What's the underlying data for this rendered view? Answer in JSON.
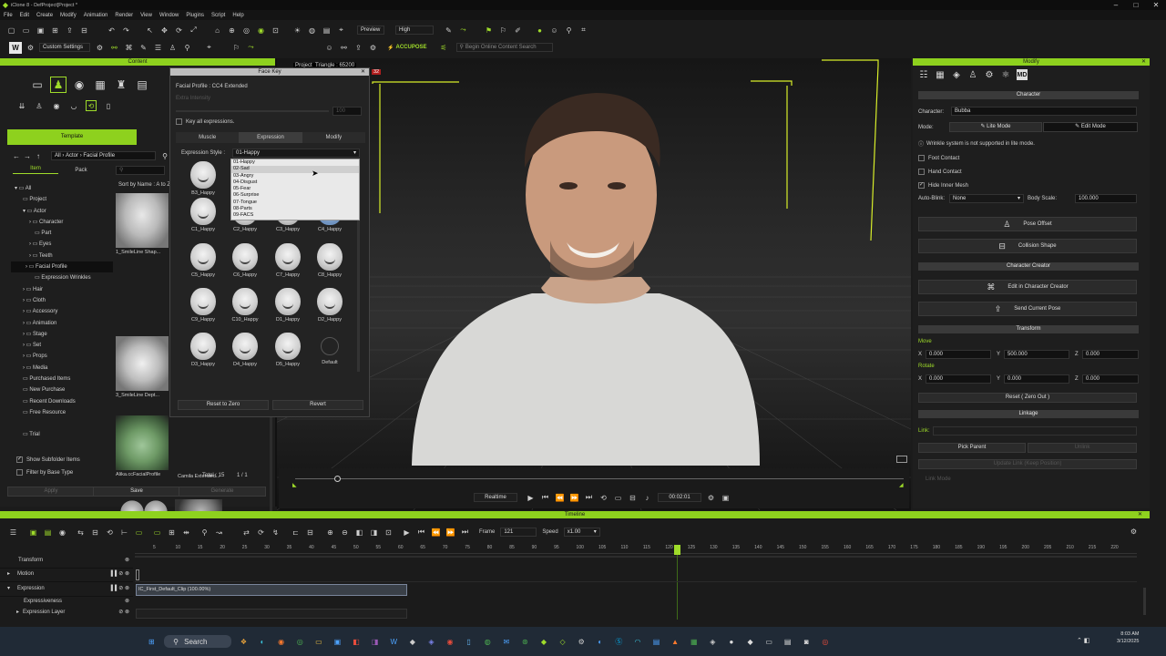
{
  "titlebar": {
    "title": "iClone 8 - DefProject[Project *"
  },
  "menu": [
    "File",
    "Edit",
    "Create",
    "Modify",
    "Animation",
    "Render",
    "View",
    "Window",
    "Plugins",
    "Script",
    "Help"
  ],
  "toolbar": {
    "preview": "Preview",
    "quality": "High",
    "custom": "Custom Settings",
    "accupose": "ACCUPOSE",
    "search_placeholder": "Begin Online Content Search"
  },
  "content": {
    "title": "Content",
    "tab_template": "Template",
    "tab_item": "Item",
    "tab_pack": "Pack",
    "path": [
      "All",
      "Actor",
      "Facial Profile"
    ],
    "sort": "Sort by Name : A to Z",
    "tree": [
      "All",
      "Project",
      "Actor",
      "Character",
      "Part",
      "Eyes",
      "Teeth",
      "Facial Profile",
      "Expression Wrinkles",
      "Hair",
      "Cloth",
      "Accessory",
      "Animation",
      "Stage",
      "Set",
      "Props",
      "Media",
      "Purchased Items",
      "New Purchase",
      "Recent Downloads",
      "Free Resource",
      "Trial"
    ],
    "thumbs": [
      "1_SmileLine Shap...",
      "3_SmileLine Dept...",
      "Alika.ccFacialProfile",
      "Camila Extended..."
    ],
    "show_sub": "Show Subfolder Items",
    "filter_base": "Filter by Base Type",
    "total": "Total : 15",
    "page": "1 / 1",
    "apply": "Apply",
    "save": "Save",
    "generate": "Generate"
  },
  "facekey": {
    "title": "Face Key",
    "profile": "Facial Profile : CC4 Extended",
    "strength": "Extra Intensity",
    "strength_val": "100",
    "key_all": "Key all expressions.",
    "tabs": [
      "Muscle",
      "Expression",
      "Modify"
    ],
    "style_label": "Expression Style :",
    "style_value": "01-Happy",
    "options": [
      "01-Happy",
      "02-Sad",
      "03-Angry",
      "04-Disgust",
      "05-Fear",
      "06-Surprise",
      "07-Tongue",
      "08-Parts",
      "09-FACS"
    ],
    "faces": [
      "B3_Happy",
      "C1_Happy",
      "C2_Happy",
      "C3_Happy",
      "C4_Happy",
      "C5_Happy",
      "C6_Happy",
      "C7_Happy",
      "C8_Happy",
      "C9_Happy",
      "C10_Happy",
      "D1_Happy",
      "D2_Happy",
      "D3_Happy",
      "D4_Happy",
      "D5_Happy",
      "Default"
    ],
    "reset": "Reset to Zero",
    "revert": "Revert"
  },
  "viewport": {
    "stats": "Project_Triangle : 65200",
    "frame_badge": "32"
  },
  "playback": {
    "mode": "Realtime",
    "time": "00:02:01"
  },
  "modify": {
    "title": "Modify",
    "character_section": "Character",
    "character_label": "Character:",
    "character_name": "Bubba",
    "mode_label": "Mode:",
    "lite": "Lite Mode",
    "edit": "Edit Mode",
    "wrinkle_note": "Wrinkle system is not supported in lite mode.",
    "foot": "Foot Contact",
    "hand": "Hand Contact",
    "hide_inner": "Hide Inner Mesh",
    "autoblink_label": "Auto-Blink:",
    "autoblink": "None",
    "bodyscale_label": "Body Scale:",
    "bodyscale": "100.000",
    "pose_offset": "Pose Offset",
    "collision": "Collision Shape",
    "cc_section": "Character Creator",
    "edit_cc": "Edit in Character Creator",
    "send_pose": "Send Current Pose",
    "transform_section": "Transform",
    "move": "Move",
    "rotate": "Rotate",
    "move_x": "0.000",
    "move_y": "500.000",
    "move_z": "0.000",
    "rot_x": "0.000",
    "rot_y": "0.000",
    "rot_z": "0.000",
    "reset": "Reset ( Zero Out )",
    "linkage_section": "Linkage",
    "link": "Link:",
    "pick_parent": "Pick Parent",
    "unlink": "Unlink",
    "update_link": "Update Link (Keep Position)",
    "link_mode": "Link Mode",
    "xyz": [
      "X",
      "Y",
      "Z"
    ]
  },
  "timeline": {
    "title": "Timeline",
    "frame_label": "Frame",
    "frame": "121",
    "speed_label": "Speed",
    "speed": "x1.00",
    "ticks": [
      "5",
      "10",
      "15",
      "20",
      "25",
      "30",
      "35",
      "40",
      "45",
      "50",
      "55",
      "60",
      "65",
      "70",
      "75",
      "80",
      "85",
      "90",
      "95",
      "100",
      "105",
      "110",
      "115",
      "120",
      "125",
      "130",
      "135",
      "140",
      "145",
      "150",
      "155",
      "160",
      "165",
      "170",
      "175",
      "180",
      "185",
      "190",
      "195",
      "200",
      "205",
      "210",
      "215",
      "220"
    ],
    "tracks": [
      "Transform",
      "Motion",
      "Expression",
      "Expressiveness",
      "Expression Layer"
    ],
    "clip": "IC_First_Default_Clip (100.00%)"
  },
  "taskbar": {
    "search": "Search",
    "time": "8:03 AM",
    "date": "3/12/2025"
  }
}
